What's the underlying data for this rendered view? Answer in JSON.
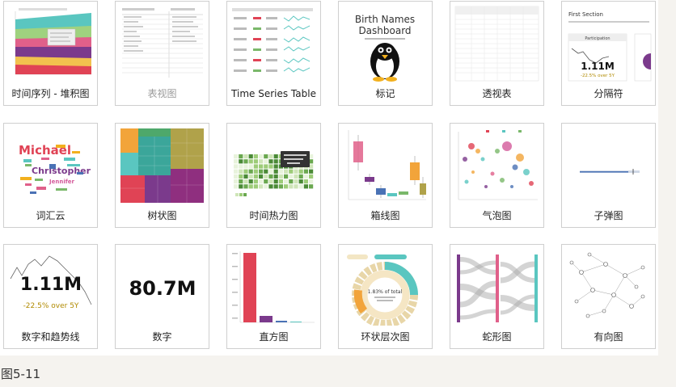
{
  "gallery": {
    "cards": [
      {
        "label": "时间序列 - 堆积图",
        "muted": false
      },
      {
        "label": "表视图",
        "muted": true
      },
      {
        "label": "Time Series Table",
        "muted": false
      },
      {
        "label": "标记",
        "muted": false
      },
      {
        "label": "透视表",
        "muted": false
      },
      {
        "label": "分隔符",
        "muted": false
      },
      {
        "label": "词汇云",
        "muted": false
      },
      {
        "label": "树状图",
        "muted": false
      },
      {
        "label": "时间热力图",
        "muted": false
      },
      {
        "label": "箱线图",
        "muted": false
      },
      {
        "label": "气泡图",
        "muted": false
      },
      {
        "label": "子弹图",
        "muted": false
      },
      {
        "label": "数字和趋势线",
        "muted": false
      },
      {
        "label": "数字",
        "muted": false
      },
      {
        "label": "直方图",
        "muted": false
      },
      {
        "label": "环状层次图",
        "muted": false
      },
      {
        "label": "蛇形图",
        "muted": false
      },
      {
        "label": "有向图",
        "muted": false
      }
    ],
    "thumbs": {
      "markup_title_line1": "Birth Names",
      "markup_title_line2": "Dashboard",
      "separator_heading": "First Section",
      "separator_panel": "Participation",
      "separator_value": "1.11M",
      "separator_change": "-22.5% over 5Y",
      "wordcloud_word1": "Michael",
      "wordcloud_word2": "Christopher",
      "wordcloud_word3": "Jennifer",
      "bignum_trend_value": "1.11M",
      "bignum_trend_change": "-22.5% over 5Y",
      "bignum_value": "80.7M",
      "sunburst_pct": "1.83% of total"
    },
    "colors": {
      "accent": "#e04355",
      "stack_teal": "#5ac6c0",
      "stack_pink": "#e0608a",
      "stack_purple": "#7b3a8c"
    }
  },
  "caption": "图5-11"
}
